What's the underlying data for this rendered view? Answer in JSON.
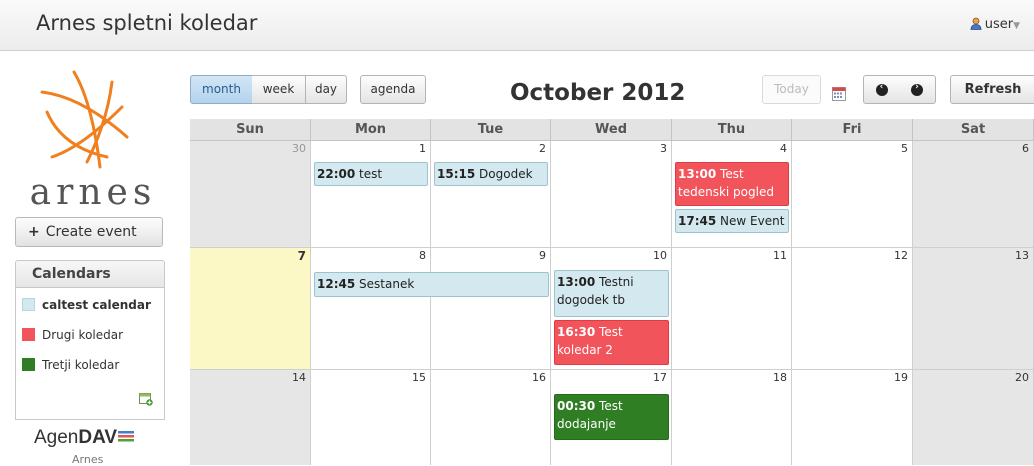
{
  "header": {
    "app_title": "Arnes spletni koledar",
    "user": "user"
  },
  "sidebar": {
    "logo_text": "arnes",
    "create_event": "Create event",
    "calendars_title": "Calendars",
    "calendars": [
      {
        "name": "caltest calendar",
        "color": "#d4e9ef"
      },
      {
        "name": "Drugi koledar",
        "color": "#f2545b"
      },
      {
        "name": "Tretji koledar",
        "color": "#2f7e24"
      }
    ],
    "agendav_prefix": "Agen",
    "agendav_bold": "DAV",
    "footer_org": "Arnes"
  },
  "toolbar": {
    "views": [
      "month",
      "week",
      "day"
    ],
    "active_view": "month",
    "agenda": "agenda",
    "title": "October 2012",
    "today": "Today",
    "refresh": "Refresh"
  },
  "calendar": {
    "weekdays": [
      "Sun",
      "Mon",
      "Tue",
      "Wed",
      "Thu",
      "Fri",
      "Sat"
    ],
    "weeks": [
      [
        "30",
        "1",
        "2",
        "3",
        "4",
        "5",
        "6"
      ],
      [
        "7",
        "8",
        "9",
        "10",
        "11",
        "12",
        "13"
      ],
      [
        "14",
        "15",
        "16",
        "17",
        "18",
        "19",
        "20"
      ]
    ],
    "events": [
      {
        "time": "22:00",
        "title": "test"
      },
      {
        "time": "15:15",
        "title": "Dogodek"
      },
      {
        "time": "13:00",
        "title": "Test tedenski pogled"
      },
      {
        "time": "17:45",
        "title": "New Event"
      },
      {
        "time": "12:45",
        "title": "Sestanek"
      },
      {
        "time": "13:00",
        "title": "Testni dogodek tb"
      },
      {
        "time": "16:30",
        "title": "Test koledar 2"
      },
      {
        "time": "00:30",
        "title": "Test dodajanje"
      }
    ]
  }
}
